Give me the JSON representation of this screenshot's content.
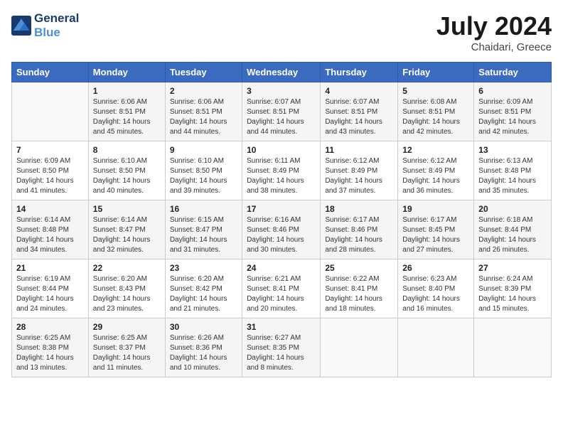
{
  "header": {
    "logo_line1": "General",
    "logo_line2": "Blue",
    "month_year": "July 2024",
    "location": "Chaidari, Greece"
  },
  "days_of_week": [
    "Sunday",
    "Monday",
    "Tuesday",
    "Wednesday",
    "Thursday",
    "Friday",
    "Saturday"
  ],
  "weeks": [
    [
      {
        "day": "",
        "sunrise": "",
        "sunset": "",
        "daylight": ""
      },
      {
        "day": "1",
        "sunrise": "6:06 AM",
        "sunset": "8:51 PM",
        "daylight": "14 hours and 45 minutes."
      },
      {
        "day": "2",
        "sunrise": "6:06 AM",
        "sunset": "8:51 PM",
        "daylight": "14 hours and 44 minutes."
      },
      {
        "day": "3",
        "sunrise": "6:07 AM",
        "sunset": "8:51 PM",
        "daylight": "14 hours and 44 minutes."
      },
      {
        "day": "4",
        "sunrise": "6:07 AM",
        "sunset": "8:51 PM",
        "daylight": "14 hours and 43 minutes."
      },
      {
        "day": "5",
        "sunrise": "6:08 AM",
        "sunset": "8:51 PM",
        "daylight": "14 hours and 42 minutes."
      },
      {
        "day": "6",
        "sunrise": "6:09 AM",
        "sunset": "8:51 PM",
        "daylight": "14 hours and 42 minutes."
      }
    ],
    [
      {
        "day": "7",
        "sunrise": "6:09 AM",
        "sunset": "8:50 PM",
        "daylight": "14 hours and 41 minutes."
      },
      {
        "day": "8",
        "sunrise": "6:10 AM",
        "sunset": "8:50 PM",
        "daylight": "14 hours and 40 minutes."
      },
      {
        "day": "9",
        "sunrise": "6:10 AM",
        "sunset": "8:50 PM",
        "daylight": "14 hours and 39 minutes."
      },
      {
        "day": "10",
        "sunrise": "6:11 AM",
        "sunset": "8:49 PM",
        "daylight": "14 hours and 38 minutes."
      },
      {
        "day": "11",
        "sunrise": "6:12 AM",
        "sunset": "8:49 PM",
        "daylight": "14 hours and 37 minutes."
      },
      {
        "day": "12",
        "sunrise": "6:12 AM",
        "sunset": "8:49 PM",
        "daylight": "14 hours and 36 minutes."
      },
      {
        "day": "13",
        "sunrise": "6:13 AM",
        "sunset": "8:48 PM",
        "daylight": "14 hours and 35 minutes."
      }
    ],
    [
      {
        "day": "14",
        "sunrise": "6:14 AM",
        "sunset": "8:48 PM",
        "daylight": "14 hours and 34 minutes."
      },
      {
        "day": "15",
        "sunrise": "6:14 AM",
        "sunset": "8:47 PM",
        "daylight": "14 hours and 32 minutes."
      },
      {
        "day": "16",
        "sunrise": "6:15 AM",
        "sunset": "8:47 PM",
        "daylight": "14 hours and 31 minutes."
      },
      {
        "day": "17",
        "sunrise": "6:16 AM",
        "sunset": "8:46 PM",
        "daylight": "14 hours and 30 minutes."
      },
      {
        "day": "18",
        "sunrise": "6:17 AM",
        "sunset": "8:46 PM",
        "daylight": "14 hours and 28 minutes."
      },
      {
        "day": "19",
        "sunrise": "6:17 AM",
        "sunset": "8:45 PM",
        "daylight": "14 hours and 27 minutes."
      },
      {
        "day": "20",
        "sunrise": "6:18 AM",
        "sunset": "8:44 PM",
        "daylight": "14 hours and 26 minutes."
      }
    ],
    [
      {
        "day": "21",
        "sunrise": "6:19 AM",
        "sunset": "8:44 PM",
        "daylight": "14 hours and 24 minutes."
      },
      {
        "day": "22",
        "sunrise": "6:20 AM",
        "sunset": "8:43 PM",
        "daylight": "14 hours and 23 minutes."
      },
      {
        "day": "23",
        "sunrise": "6:20 AM",
        "sunset": "8:42 PM",
        "daylight": "14 hours and 21 minutes."
      },
      {
        "day": "24",
        "sunrise": "6:21 AM",
        "sunset": "8:41 PM",
        "daylight": "14 hours and 20 minutes."
      },
      {
        "day": "25",
        "sunrise": "6:22 AM",
        "sunset": "8:41 PM",
        "daylight": "14 hours and 18 minutes."
      },
      {
        "day": "26",
        "sunrise": "6:23 AM",
        "sunset": "8:40 PM",
        "daylight": "14 hours and 16 minutes."
      },
      {
        "day": "27",
        "sunrise": "6:24 AM",
        "sunset": "8:39 PM",
        "daylight": "14 hours and 15 minutes."
      }
    ],
    [
      {
        "day": "28",
        "sunrise": "6:25 AM",
        "sunset": "8:38 PM",
        "daylight": "14 hours and 13 minutes."
      },
      {
        "day": "29",
        "sunrise": "6:25 AM",
        "sunset": "8:37 PM",
        "daylight": "14 hours and 11 minutes."
      },
      {
        "day": "30",
        "sunrise": "6:26 AM",
        "sunset": "8:36 PM",
        "daylight": "14 hours and 10 minutes."
      },
      {
        "day": "31",
        "sunrise": "6:27 AM",
        "sunset": "8:35 PM",
        "daylight": "14 hours and 8 minutes."
      },
      {
        "day": "",
        "sunrise": "",
        "sunset": "",
        "daylight": ""
      },
      {
        "day": "",
        "sunrise": "",
        "sunset": "",
        "daylight": ""
      },
      {
        "day": "",
        "sunrise": "",
        "sunset": "",
        "daylight": ""
      }
    ]
  ]
}
